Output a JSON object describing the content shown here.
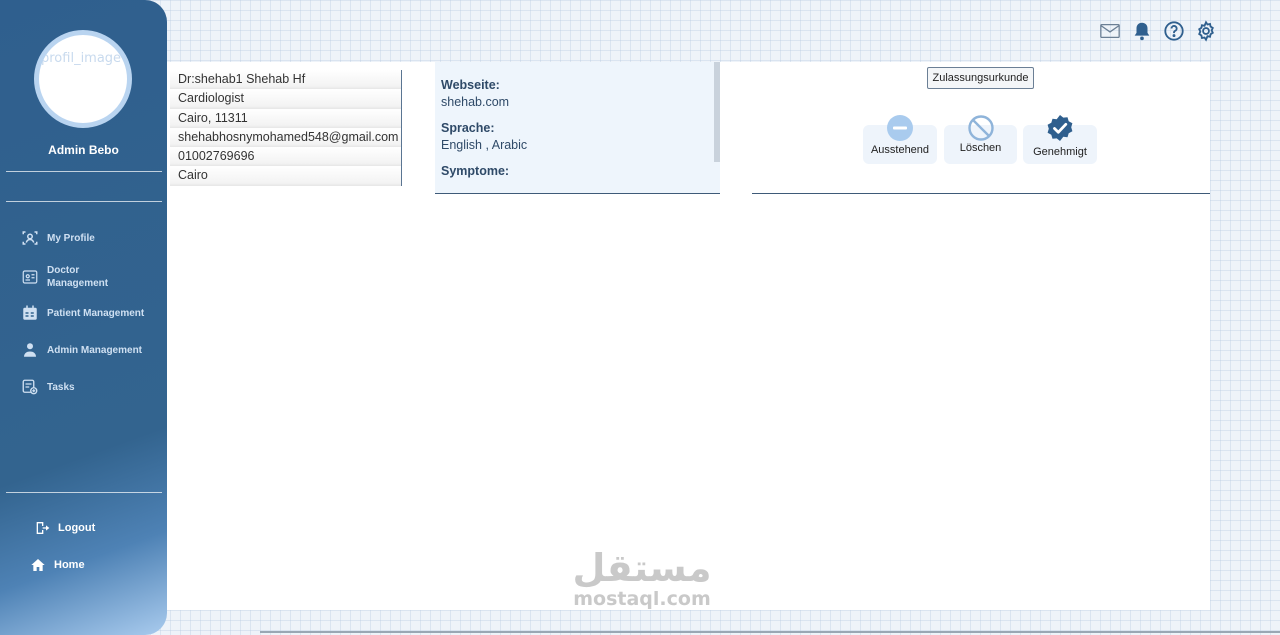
{
  "sidebar": {
    "avatar_alt": "profil_image",
    "admin_name": "Admin Bebo",
    "nav": [
      {
        "label": "My Profile",
        "icon": "profile-scan-icon"
      },
      {
        "label": "Doctor Management",
        "icon": "doctor-card-icon"
      },
      {
        "label": "Patient Management",
        "icon": "calendar-icon"
      },
      {
        "label": "Admin Management",
        "icon": "user-icon"
      },
      {
        "label": "Tasks",
        "icon": "tasks-icon"
      }
    ],
    "bottom": [
      {
        "label": "Logout",
        "icon": "logout-icon"
      },
      {
        "label": "Home",
        "icon": "home-icon"
      }
    ]
  },
  "header_icons": [
    "mail-icon",
    "bell-icon",
    "help-icon",
    "settings-icon"
  ],
  "doctor": {
    "name": "Dr:shehab1 Shehab Hf",
    "specialty": "Cardiologist",
    "address": "Cairo, 11311",
    "email": "shehabhosnymohamed548@gmail.com",
    "phone": "01002769696",
    "city": "Cairo"
  },
  "details": {
    "website_label": "Webseite:",
    "website": "shehab.com",
    "language_label": "Sprache:",
    "languages": "English , Arabic",
    "symptoms_label": "Symptome:"
  },
  "approval": {
    "certificate_button": "Zulassungsurkunde",
    "statuses": [
      {
        "label": "Ausstehend",
        "icon": "minus-circle-icon"
      },
      {
        "label": "Löschen",
        "icon": "ban-icon"
      },
      {
        "label": "Genehmigt",
        "icon": "verified-badge-icon"
      }
    ]
  },
  "watermark": {
    "arabic": "مستقل",
    "latin": "mostaql.com"
  },
  "colors": {
    "sidebar": "#2f5f8e",
    "accent": "#3b6ea5",
    "panel_bg": "#eef5fc"
  }
}
